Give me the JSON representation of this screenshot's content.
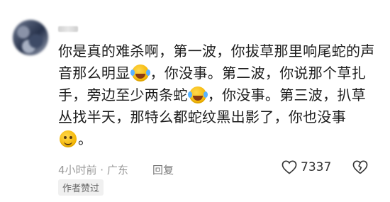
{
  "comment": {
    "lines": [
      "你是真的难杀啊，第一波，你拔草那里响尾蛇的声",
      "音那么明显",
      "，你没事。第二波，你说那个草扎",
      "手，旁边至少两条蛇",
      "，你没事。第三波，扒草",
      "丛找半天，那特么都蛇纹黑出影了，你也没事",
      "。"
    ]
  },
  "meta": {
    "time_location": "4小时前 · 广东",
    "reply": "回复"
  },
  "likes": {
    "count": "7337"
  },
  "badge": {
    "text": "作者赞过"
  },
  "icons": {
    "emoji_1": "laughing-tears-emoji",
    "emoji_2": "laughing-tears-emoji",
    "emoji_3": "smile-emoji",
    "like": "heart-outline-icon",
    "dislike": "broken-heart-icon"
  }
}
